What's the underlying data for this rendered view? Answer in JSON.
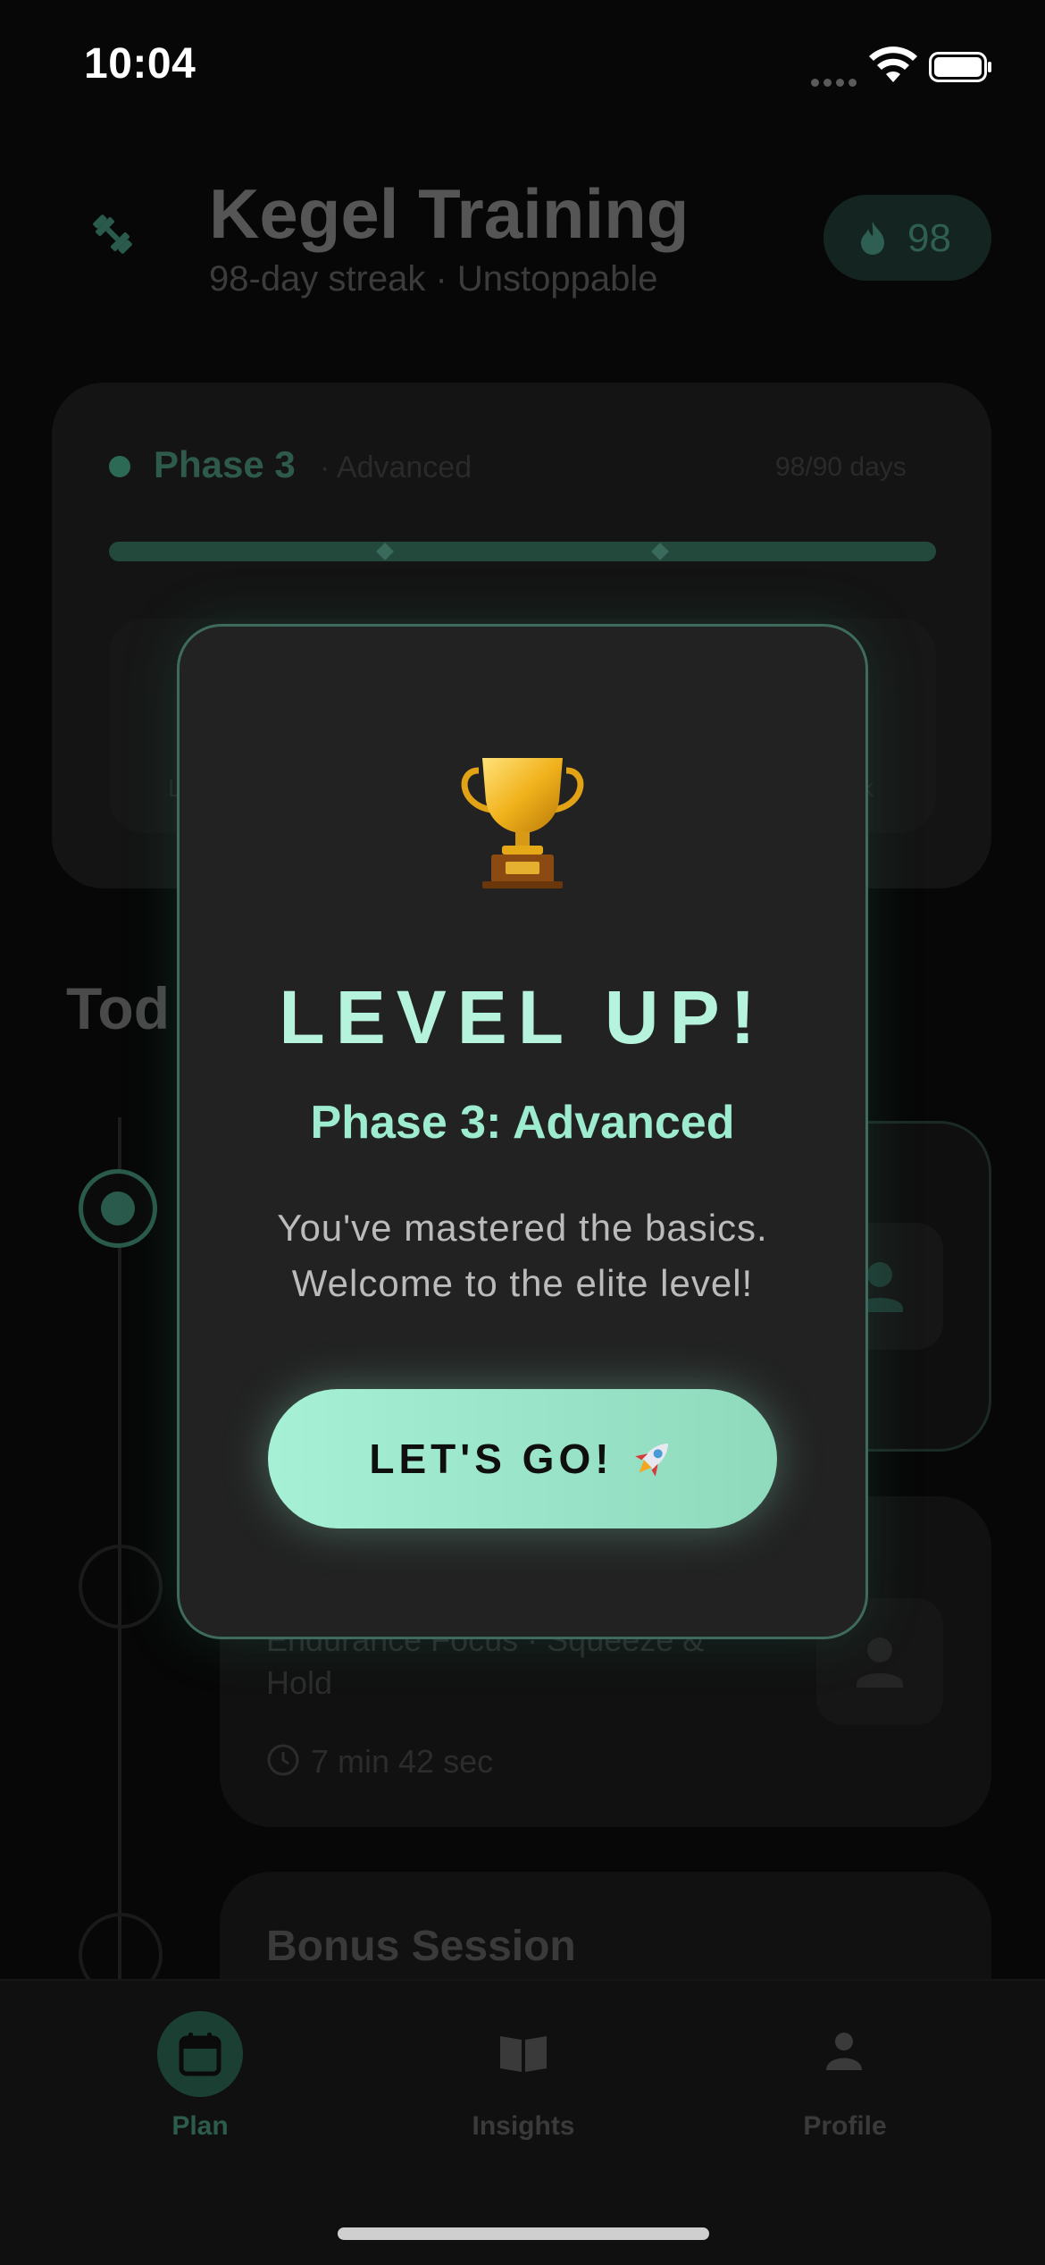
{
  "status_bar": {
    "time": "10:04"
  },
  "header": {
    "title": "Kegel Training",
    "subtitle": "98-day streak · Unstoppable",
    "streak_count": "98"
  },
  "phase_card": {
    "phase_name": "Phase 3",
    "phase_level": "· Advanced",
    "days": "98/90 days",
    "progress": 1.0,
    "inner_left_label": "L",
    "inner_right_label": "ck"
  },
  "today_section": {
    "heading": "Tod",
    "sessions": [
      {
        "line1": "Endurance Focus · Squeeze &",
        "line2": "Hold",
        "duration": "7 min 42 sec"
      },
      {
        "title": "Bonus Session"
      }
    ]
  },
  "tabs": [
    {
      "label": "Plan",
      "icon": "calendar-icon",
      "active": true
    },
    {
      "label": "Insights",
      "icon": "book-icon",
      "active": false
    },
    {
      "label": "Profile",
      "icon": "person-icon",
      "active": false
    }
  ],
  "modal": {
    "icon": "trophy-icon",
    "heading": "LEVEL UP!",
    "phase": "Phase 3: Advanced",
    "message_line1": "You've mastered the basics.",
    "message_line2": "Welcome to the elite level!",
    "cta_label": "LET'S GO!",
    "cta_icon": "rocket-icon"
  },
  "colors": {
    "accent": "#9eeccf",
    "modal_bg": "#222222",
    "modal_border": "#3f6a5e",
    "cta_start": "#a6f1d6",
    "cta_end": "#8fd9bd"
  }
}
